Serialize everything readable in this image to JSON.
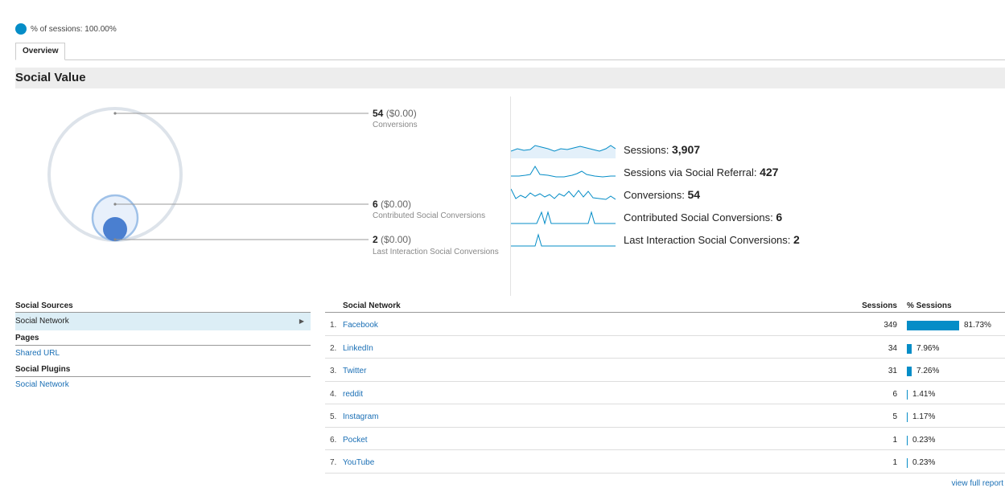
{
  "segment": {
    "label": "% of sessions: 100.00%",
    "color": "#058dc7"
  },
  "tabs": [
    {
      "label": "Overview"
    }
  ],
  "section_title": "Social Value",
  "conversions": [
    {
      "value": "54",
      "money": "($0.00)",
      "label": "Conversions"
    },
    {
      "value": "6",
      "money": "($0.00)",
      "label": "Contributed Social Conversions"
    },
    {
      "value": "2",
      "money": "($0.00)",
      "label": "Last Interaction Social Conversions"
    }
  ],
  "metrics": [
    {
      "label": "Sessions: ",
      "value": "3,907"
    },
    {
      "label": "Sessions via Social Referral: ",
      "value": "427"
    },
    {
      "label": "Conversions: ",
      "value": "54"
    },
    {
      "label": "Contributed Social Conversions: ",
      "value": "6"
    },
    {
      "label": "Last Interaction Social Conversions: ",
      "value": "2"
    }
  ],
  "sources": {
    "header": "Social Sources",
    "selected_item": "Social Network",
    "pages_header": "Pages",
    "pages_item": "Shared URL",
    "plugins_header": "Social Plugins",
    "plugins_item": "Social Network"
  },
  "table": {
    "col_network": "Social Network",
    "col_sessions": "Sessions",
    "col_pct": "% Sessions",
    "rows": [
      {
        "num": "1.",
        "name": "Facebook",
        "sessions": "349",
        "pct": "81.73%",
        "share": 0.8173
      },
      {
        "num": "2.",
        "name": "LinkedIn",
        "sessions": "34",
        "pct": "7.96%",
        "share": 0.0796
      },
      {
        "num": "3.",
        "name": "Twitter",
        "sessions": "31",
        "pct": "7.26%",
        "share": 0.0726
      },
      {
        "num": "4.",
        "name": "reddit",
        "sessions": "6",
        "pct": "1.41%",
        "share": 0.0141
      },
      {
        "num": "5.",
        "name": "Instagram",
        "sessions": "5",
        "pct": "1.17%",
        "share": 0.0117
      },
      {
        "num": "6.",
        "name": "Pocket",
        "sessions": "1",
        "pct": "0.23%",
        "share": 0.0023
      },
      {
        "num": "7.",
        "name": "YouTube",
        "sessions": "1",
        "pct": "0.23%",
        "share": 0.0023
      }
    ],
    "full_report": "view full report"
  },
  "colors": {
    "accent": "#058dc7",
    "link": "#1a6fb5",
    "circle_inner": "#4a7fd0",
    "circle_mid": "#9fc1e8",
    "circle_outer": "#dde3ea"
  }
}
